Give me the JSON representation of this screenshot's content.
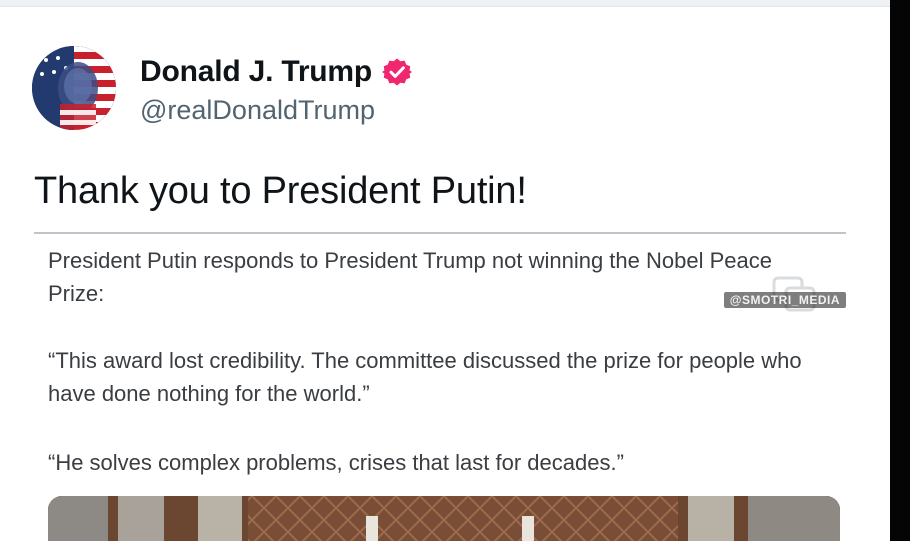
{
  "post": {
    "author": {
      "display_name": "Donald J. Trump",
      "handle": "@realDonaldTrump",
      "verified_badge_icon": "verified-badge-icon",
      "verified_color": "#f0266f"
    },
    "text": "Thank you to President Putin!",
    "quoted_image": {
      "paragraphs": [
        "President Putin responds to President Trump not winning the Nobel Peace Prize:",
        "“This award lost credibility. The committee discussed the prize for people who have done nothing for the world.”",
        "“He solves complex problems, crises that last for decades.”"
      ],
      "media_watermark": "@SMOTRI_MEDIA"
    }
  }
}
